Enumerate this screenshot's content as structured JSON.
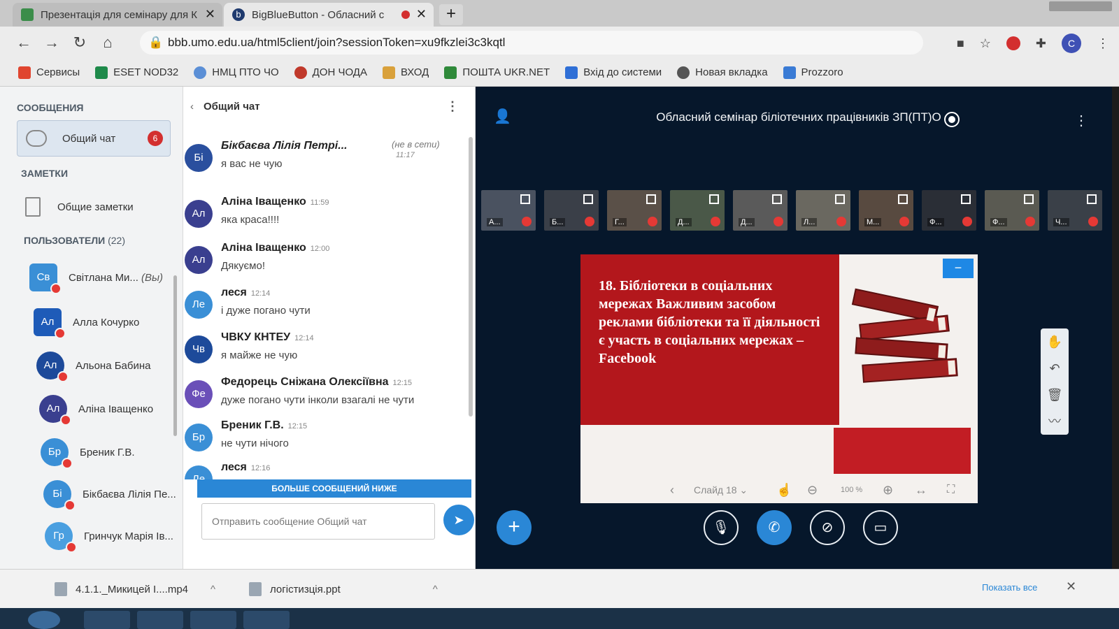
{
  "browser": {
    "tabs": [
      {
        "title": "Презентація для семінару для К",
        "active": false
      },
      {
        "title": "BigBlueButton - Обласний с",
        "active": true
      }
    ],
    "url": "bbb.umo.edu.ua/html5client/join?sessionToken=xu9fkzlei3c3kqtl",
    "profile_letter": "C",
    "bookmarks": [
      {
        "label": "Сервисы"
      },
      {
        "label": "ESET NOD32"
      },
      {
        "label": "НМЦ ПТО ЧО"
      },
      {
        "label": "ДОН ЧОДА"
      },
      {
        "label": "ВХОД"
      },
      {
        "label": "ПОШТА UKR.NET"
      },
      {
        "label": "Вхід до системи"
      },
      {
        "label": "Новая вкладка"
      },
      {
        "label": "Prozzoro"
      }
    ]
  },
  "sidebar": {
    "messages_heading": "СООБЩЕНИЯ",
    "public_chat": {
      "label": "Общий чат",
      "badge": "6"
    },
    "notes_heading": "ЗАМЕТКИ",
    "shared_notes": "Общие заметки",
    "users_heading": "ПОЛЬЗОВАТЕЛИ",
    "users_count": "(22)",
    "you_label": "(Вы)",
    "users": [
      {
        "initials": "Св",
        "name": "Світлана Ми...",
        "color": "#3a8fd6"
      },
      {
        "initials": "Ал",
        "name": "Алла Кочурко",
        "color": "#1e5bb8"
      },
      {
        "initials": "Ал",
        "name": "Альона Бабина",
        "color": "#1d4a9a"
      },
      {
        "initials": "Ал",
        "name": "Аліна Іващенко",
        "color": "#3a3f8f"
      },
      {
        "initials": "Бр",
        "name": "Бреник Г.В.",
        "color": "#3a8fd6"
      },
      {
        "initials": "Бі",
        "name": "Бікбаєва Лілія Пе...",
        "color": "#3a8fd6"
      },
      {
        "initials": "Гр",
        "name": "Гринчук Марія Ів...",
        "color": "#4a9fe0"
      }
    ]
  },
  "chat": {
    "title": "Общий чат",
    "offline_label": "(не в сети)",
    "messages": [
      {
        "initials": "Бі",
        "name": "Бікбаєва Лілія Петрі...",
        "time": "11:17",
        "text": "я вас не чую",
        "color": "#2a4f9e"
      },
      {
        "initials": "Ал",
        "name": "Аліна Іващенко",
        "time": "11:59",
        "text": "яка краса!!!!",
        "color": "#3a3f8f"
      },
      {
        "initials": "Ал",
        "name": "Аліна Іващенко",
        "time": "12:00",
        "text": "Дякуємо!",
        "color": "#3a3f8f"
      },
      {
        "initials": "Ле",
        "name": "леся",
        "time": "12:14",
        "text": "і дуже погано чути",
        "color": "#3a8fd6"
      },
      {
        "initials": "Чв",
        "name": "ЧВКУ КНТЕУ",
        "time": "12:14",
        "text": "я майже не чую",
        "color": "#1d4a9a"
      },
      {
        "initials": "Фе",
        "name": "Федорець Сніжана Олексіївна",
        "time": "12:15",
        "text": "дуже погано чути інколи взагалі не чути",
        "color": "#6a4fb8"
      },
      {
        "initials": "Бр",
        "name": "Бреник Г.В.",
        "time": "12:15",
        "text": "не чути нічого",
        "color": "#3a8fd6"
      },
      {
        "initials": "Ле",
        "name": "леся",
        "time": "12:16",
        "text": "",
        "color": "#3a8fd6"
      }
    ],
    "more_messages_label": "БОЛЬШЕ СООБЩЕНИЙ НИЖЕ",
    "input_placeholder": "Отправить сообщение Общий чат"
  },
  "presentation": {
    "meeting_title": "Обласний семінар біліотечних працівників ЗП(ПТ)О",
    "webcam_tiles": [
      "А...",
      "Б...",
      "Г...",
      "Д...",
      "Д...",
      "Л...",
      "М...",
      "Ф...",
      "Ф...",
      "Ч..."
    ],
    "slide_text": "18. Бібліотеки в соціальних мережах Важливим засобом реклами бібліотеки та її діяльності є участь в соціальних мережах – Facebook",
    "slide_selector": "Слайд 18",
    "zoom": "100 %"
  },
  "downloads": [
    {
      "name": "4.1.1._Микицей І....mp4"
    },
    {
      "name": "логістизція.ppt"
    }
  ],
  "downloads_show_all": "Показать все",
  "colors": {
    "accent": "#2a87d6",
    "stage_bg": "#06172b",
    "slide_red": "#b3171c",
    "mute_red": "#e53935"
  }
}
